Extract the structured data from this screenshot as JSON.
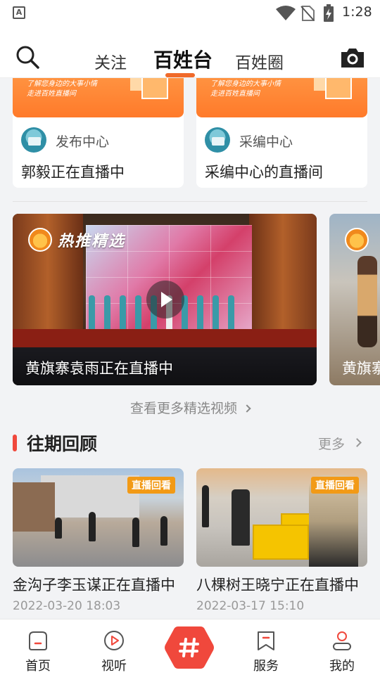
{
  "status_bar": {
    "time": "1:28",
    "notification_icon": "A"
  },
  "header": {
    "tabs": [
      {
        "label": "关注",
        "active": false
      },
      {
        "label": "百姓台",
        "active": true
      },
      {
        "label": "百姓圈",
        "active": false
      }
    ],
    "accent_color": "#f06a2a"
  },
  "live_cards": [
    {
      "banner_line1": "了解您身边的大事小情",
      "banner_line2": "走进百姓直播间",
      "source": "发布中心",
      "title": "郭毅正在直播中"
    },
    {
      "banner_line1": "了解您身边的大事小情",
      "banner_line2": "走进百姓直播间",
      "source": "采编中心",
      "title": "采编中心的直播间"
    }
  ],
  "featured": {
    "badge": "热推精选",
    "items": [
      {
        "title": "黄旗寨袁雨正在直播中"
      },
      {
        "title": "黄旗寨"
      }
    ],
    "more_link": "查看更多精选视频"
  },
  "past_section": {
    "title": "往期回顾",
    "more": "更多",
    "items": [
      {
        "tag": "直播回看",
        "title": "金沟子李玉谋正在直播中",
        "date": "2022-03-20 18:03"
      },
      {
        "tag": "直播回看",
        "title": "八棵树王晓宁正在直播中",
        "date": "2022-03-17 15:10"
      }
    ]
  },
  "bottom_nav": {
    "items": [
      {
        "label": "首页",
        "icon": "home-icon"
      },
      {
        "label": "视听",
        "icon": "play-circle-icon"
      },
      {
        "label": "",
        "icon": "hashtag-icon"
      },
      {
        "label": "服务",
        "icon": "bookmark-icon"
      },
      {
        "label": "我的",
        "icon": "user-icon"
      }
    ],
    "accent_color": "#f0483c"
  }
}
